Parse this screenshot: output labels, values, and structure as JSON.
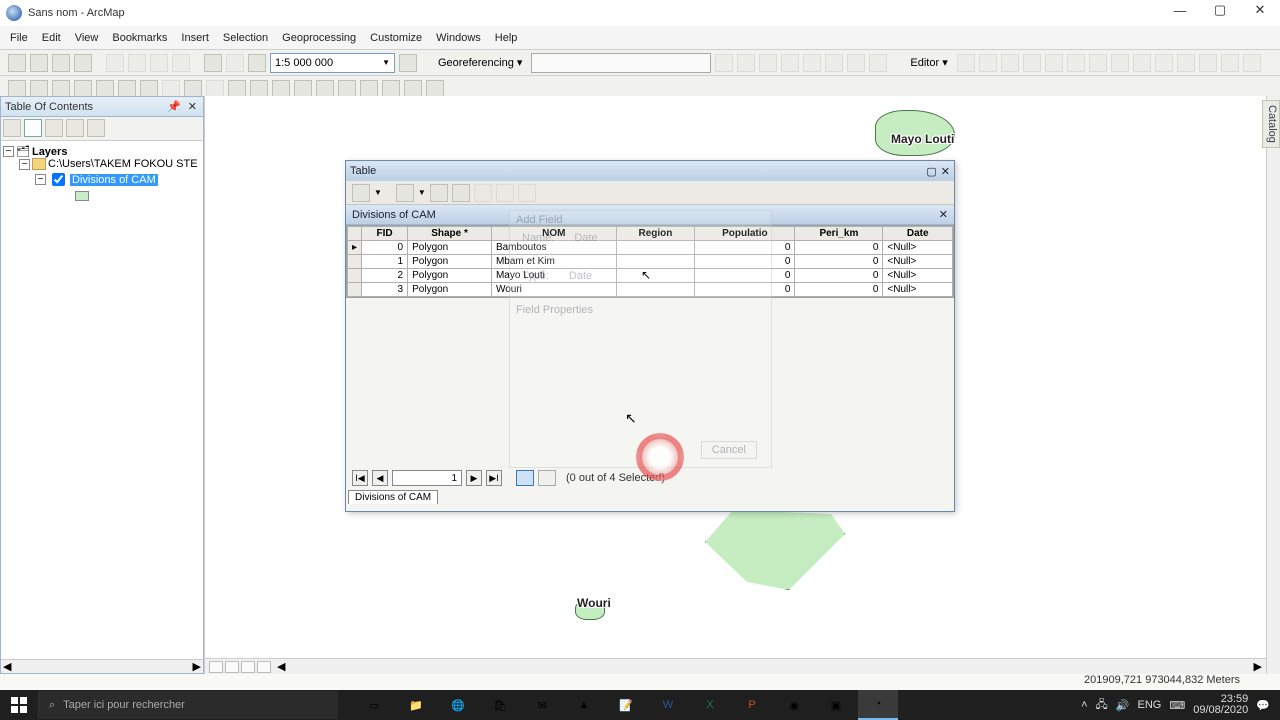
{
  "window": {
    "title": "Sans nom - ArcMap"
  },
  "menu": [
    "File",
    "Edit",
    "View",
    "Bookmarks",
    "Insert",
    "Selection",
    "Geoprocessing",
    "Customize",
    "Windows",
    "Help"
  ],
  "scale": "1:5 000 000",
  "georef_label": "Georeferencing",
  "editor_label": "Editor",
  "toc": {
    "title": "Table Of Contents",
    "root": "Layers",
    "folder": "C:\\Users\\TAKEM FOKOU STE",
    "layer": "Divisions of CAM"
  },
  "map": {
    "label1": "Mayo Louti",
    "label2": "Wouri"
  },
  "tablewin": {
    "title": "Table",
    "subtitle": "Divisions of CAM",
    "columns": [
      "FID",
      "Shape *",
      "NOM",
      "Region",
      "Populatio",
      "Peri_km",
      "Date"
    ],
    "rows": [
      {
        "fid": "0",
        "shape": "Polygon",
        "nom": "Bamboutos",
        "region": "",
        "pop": "0",
        "peri": "0",
        "date": "<Null>"
      },
      {
        "fid": "1",
        "shape": "Polygon",
        "nom": "Mbam et Kim",
        "region": "",
        "pop": "0",
        "peri": "0",
        "date": "<Null>"
      },
      {
        "fid": "2",
        "shape": "Polygon",
        "nom": "Mayo Louti",
        "region": "",
        "pop": "0",
        "peri": "0",
        "date": "<Null>"
      },
      {
        "fid": "3",
        "shape": "Polygon",
        "nom": "Wouri",
        "region": "",
        "pop": "0",
        "peri": "0",
        "date": "<Null>"
      }
    ],
    "nav_value": "1",
    "selection_text": "(0 out of 4 Selected)",
    "foot_tab": "Divisions of CAM"
  },
  "addfield": {
    "title": "Add Field",
    "name_label": "Name:",
    "name_value": "Date",
    "type_label": "Type:",
    "type_value": "Date",
    "section": "Field Properties",
    "cancel": "Cancel"
  },
  "catalog_tab": "Catalog",
  "status_coords": "201909,721  973044,832 Meters",
  "taskbar": {
    "search_placeholder": "Taper ici pour rechercher",
    "lang": "ENG",
    "time": "23:59",
    "date": "09/08/2020"
  }
}
